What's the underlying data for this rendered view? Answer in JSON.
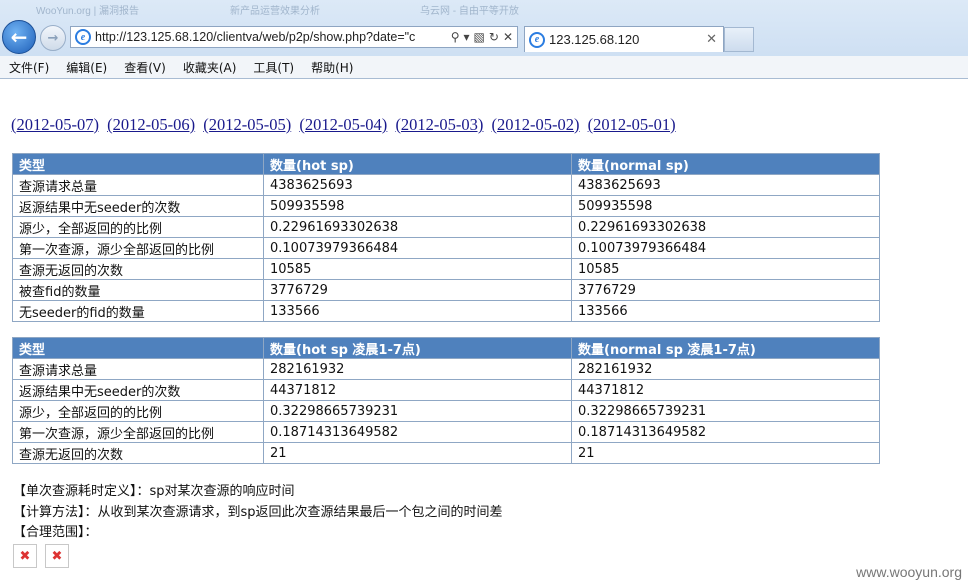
{
  "browser": {
    "ghost_tabs": [
      "WooYun.org | 漏洞报告",
      "新产品运营效果分析",
      "乌云网 - 自由平等开放"
    ],
    "address": "http://123.125.68.120/clientva/web/p2p/show.php?date=\"c",
    "tab_title": "123.125.68.120",
    "menu": [
      "文件(F)",
      "编辑(E)",
      "查看(V)",
      "收藏夹(A)",
      "工具(T)",
      "帮助(H)"
    ]
  },
  "date_links": [
    "(2012-05-07)",
    "(2012-05-06)",
    "(2012-05-05)",
    "(2012-05-04)",
    "(2012-05-03)",
    "(2012-05-02)",
    "(2012-05-01)"
  ],
  "table1": {
    "headers": [
      "类型",
      "数量(hot sp)",
      "数量(normal sp)"
    ],
    "rows": [
      [
        "查源请求总量",
        "4383625693",
        "4383625693"
      ],
      [
        "返源结果中无seeder的次数",
        "509935598",
        "509935598"
      ],
      [
        "源少，全部返回的的比例",
        "0.22961693302638",
        "0.22961693302638"
      ],
      [
        "第一次查源，源少全部返回的比例",
        "0.10073979366484",
        "0.10073979366484"
      ],
      [
        "查源无返回的次数",
        "10585",
        "10585"
      ],
      [
        "被查fid的数量",
        "3776729",
        "3776729"
      ],
      [
        "无seeder的fid的数量",
        "133566",
        "133566"
      ]
    ]
  },
  "table2": {
    "headers": [
      "类型",
      "数量(hot sp 凌晨1-7点)",
      "数量(normal sp 凌晨1-7点)"
    ],
    "rows": [
      [
        "查源请求总量",
        "282161932",
        "282161932"
      ],
      [
        "返源结果中无seeder的次数",
        "44371812",
        "44371812"
      ],
      [
        "源少，全部返回的的比例",
        "0.32298665739231",
        "0.32298665739231"
      ],
      [
        "第一次查源，源少全部返回的比例",
        "0.18714313649582",
        "0.18714313649582"
      ],
      [
        "查源无返回的次数",
        "21",
        "21"
      ]
    ]
  },
  "notes": [
    "【单次查源耗时定义】：sp对某次查源的响应时间",
    "【计算方法】：从收到某次查源请求，到sp返回此次查源结果最后一个包之间的时间差",
    "【合理范围】："
  ],
  "watermark": "www.wooyun.org"
}
